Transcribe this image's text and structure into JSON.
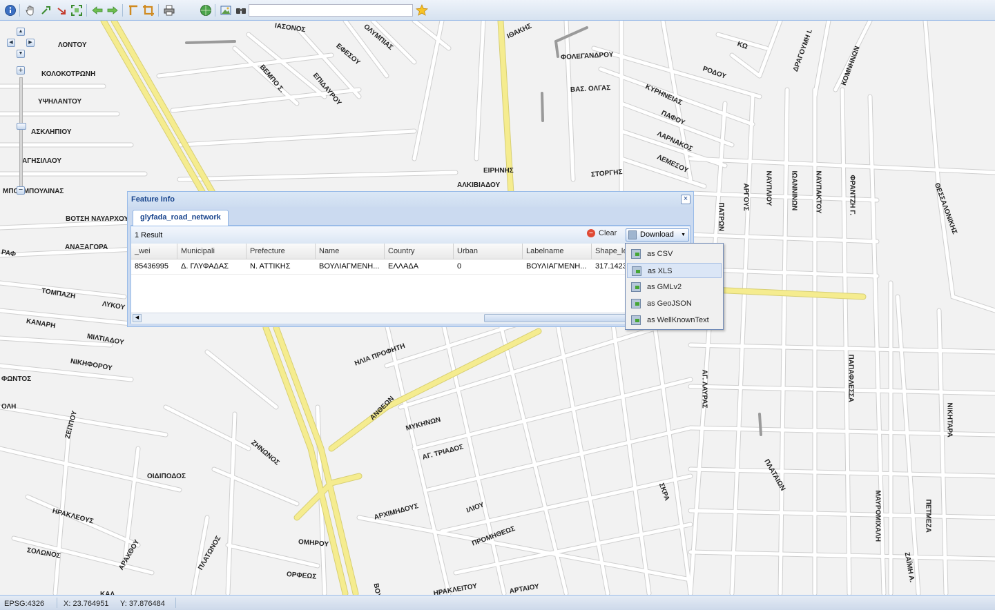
{
  "toolbar": {
    "search_value": "",
    "buttons": [
      "info-icon",
      "pan-icon",
      "zoom-in-icon",
      "zoom-out-icon",
      "zoom-extent-icon",
      "back-icon",
      "forward-icon",
      "measure-length-icon",
      "measure-area-icon",
      "print-icon",
      "globe-icon",
      "image-icon",
      "binoculars-icon",
      "star-icon"
    ]
  },
  "map": {
    "streets": [
      "ΙΑΣΟΝΟΣ",
      "ΟΛΥΜΠΙΑΣ",
      "ΕΦΕΣΟΥ",
      "ΕΠΙΔΑΥΡΟΥ",
      "ΒΕΜΠΟ Σ.",
      "ΙΘΑΚΗΣ",
      "ΦΟΛΕΓΑΝΔΡΟΥ",
      "ΒΑΣ. ΟΛΓΑΣ",
      "ΚΩ",
      "ΡΟΔΟΥ",
      "ΚΥΡΗΝΕΙΑΣ",
      "ΠΑΦΟΥ",
      "ΛΑΡΝΑΚΟΣ",
      "ΛΕΜΕΣΟΥ",
      "ΔΡΑΓΟΥΜΗ Ι.",
      "ΚΟΜΝΗΝΩΝ",
      "ΛΟΝΤΟΥ",
      "ΚΟΛΟΚΟΤΡΩΝΗ",
      "ΥΨΗΛΑΝΤΟΥ",
      "ΑΣΚΛΗΠΙΟΥ",
      "ΑΓΗΣΙΛΑΟΥ",
      "ΜΠΟΥΜΠΟΥΛΙΝΑΣ",
      "ΕΙΡΗΝΗΣ",
      "ΑΛΚΙΒΙΑΔΟΥ",
      "ΣΤΟΡΓΗΣ",
      "ΠΑΤΡΩΝ",
      "ΑΡΓΟΥΣ",
      "ΝΑΥΠΛΙΟΥ",
      "ΙΩΑΝΝΙΝΩΝ",
      "ΝΑΥΠΑΚΤΟΥ",
      "ΦΡΑΝΤΖΗ Γ.",
      "ΘΕΣΣΑΛΟΝΙΚΗΣ",
      "ΒΟΤΣΗ ΝΑΥΑΡΧΟΥ",
      "ΑΝΑΞΑΓΟΡΑ",
      "ΡΑΦ",
      "ΤΟΜΠΑΖΗ",
      "ΛΥΚΟΥ",
      "ΚΑΝΑΡΗ",
      "ΜΙΛΤΙΑΔΟΥ",
      "ΝΙΚΗΦΟΡΟΥ",
      "ΦΩΝΤΟΣ",
      "ΟΛΗ",
      "ΗΛΙΑ ΠΡΟΦΗΤΗ",
      "ΑΝΘΕΩΝ",
      "ΜΥΚΗΝΩΝ",
      "ΑΓ. ΤΡΙΑΔΟΣ",
      "ΖΗΝΩΝΟΣ",
      "ΖΕΠΠΟΥ",
      "ΟΙΔΙΠΟΔΟΣ",
      "ΗΡΑΚΛΕΟΥΣ",
      "ΑΡΧΙΜΗΔΟΥΣ",
      "ΙΛΙΟΥ",
      "ΠΡΟΜΗΘΕΩΣ",
      "ΟΜΗΡΟΥ",
      "ΣΟΛΩΝΟΣ",
      "ΑΡΑΧΘΟΥ",
      "ΠΛΑΤΩΝΟΣ",
      "ΟΡΦΕΩΣ",
      "ΗΡΑΚΛΕΙΤΟΥ",
      "ΑΡΤΑΙΟΥ",
      "ΑΓ. ΛΑΥΡΑΣ",
      "ΠΑΠΑΦΛΕΣΣΑ",
      "ΝΙΚΗΤΑΡΑ",
      "ΠΛΑΤΑΙΩΝ",
      "ΣΚΡΑ",
      "ΜΑΥΡΟΜΙΧΑΛΗ",
      "ΠΕΤΜΕΖΑ",
      "ΖΑΪΜΗ Α.",
      "ΒΟΥ",
      "ΚΑΛ"
    ]
  },
  "dialog": {
    "title": "Feature Info",
    "tab_label": "glyfada_road_network",
    "result_count": "1 Result",
    "clear_label": "Clear",
    "download_label": "Download",
    "columns": [
      "_wei",
      "Municipali",
      "Prefecture",
      "Name",
      "Country",
      "Urban",
      "Labelname",
      "Shape_le"
    ],
    "rows": [
      [
        "85436995",
        "Δ. ΓΛΥΦΑΔΑΣ",
        "Ν. ΑΤΤΙΚΗΣ",
        "ΒΟΥΛΙΑΓΜΕΝΗ...",
        "ΕΛΛΑΔΑ",
        "0",
        "ΒΟΥΛΙΑΓΜΕΝΗ...",
        "317.1423"
      ]
    ]
  },
  "download_menu": {
    "items": [
      "as CSV",
      "as XLS",
      "as GMLv2",
      "as GeoJSON",
      "as WellKnownText"
    ],
    "highlighted": "as XLS"
  },
  "statusbar": {
    "projection": "EPSG:4326",
    "x": "X: 23.764951",
    "y": "Y: 37.876484"
  },
  "colors": {
    "major_road": "#f5ec8f",
    "road": "#ffffff",
    "road_casing": "#cfcfcf",
    "panel_border": "#99bbe8",
    "title_text": "#15428b"
  }
}
